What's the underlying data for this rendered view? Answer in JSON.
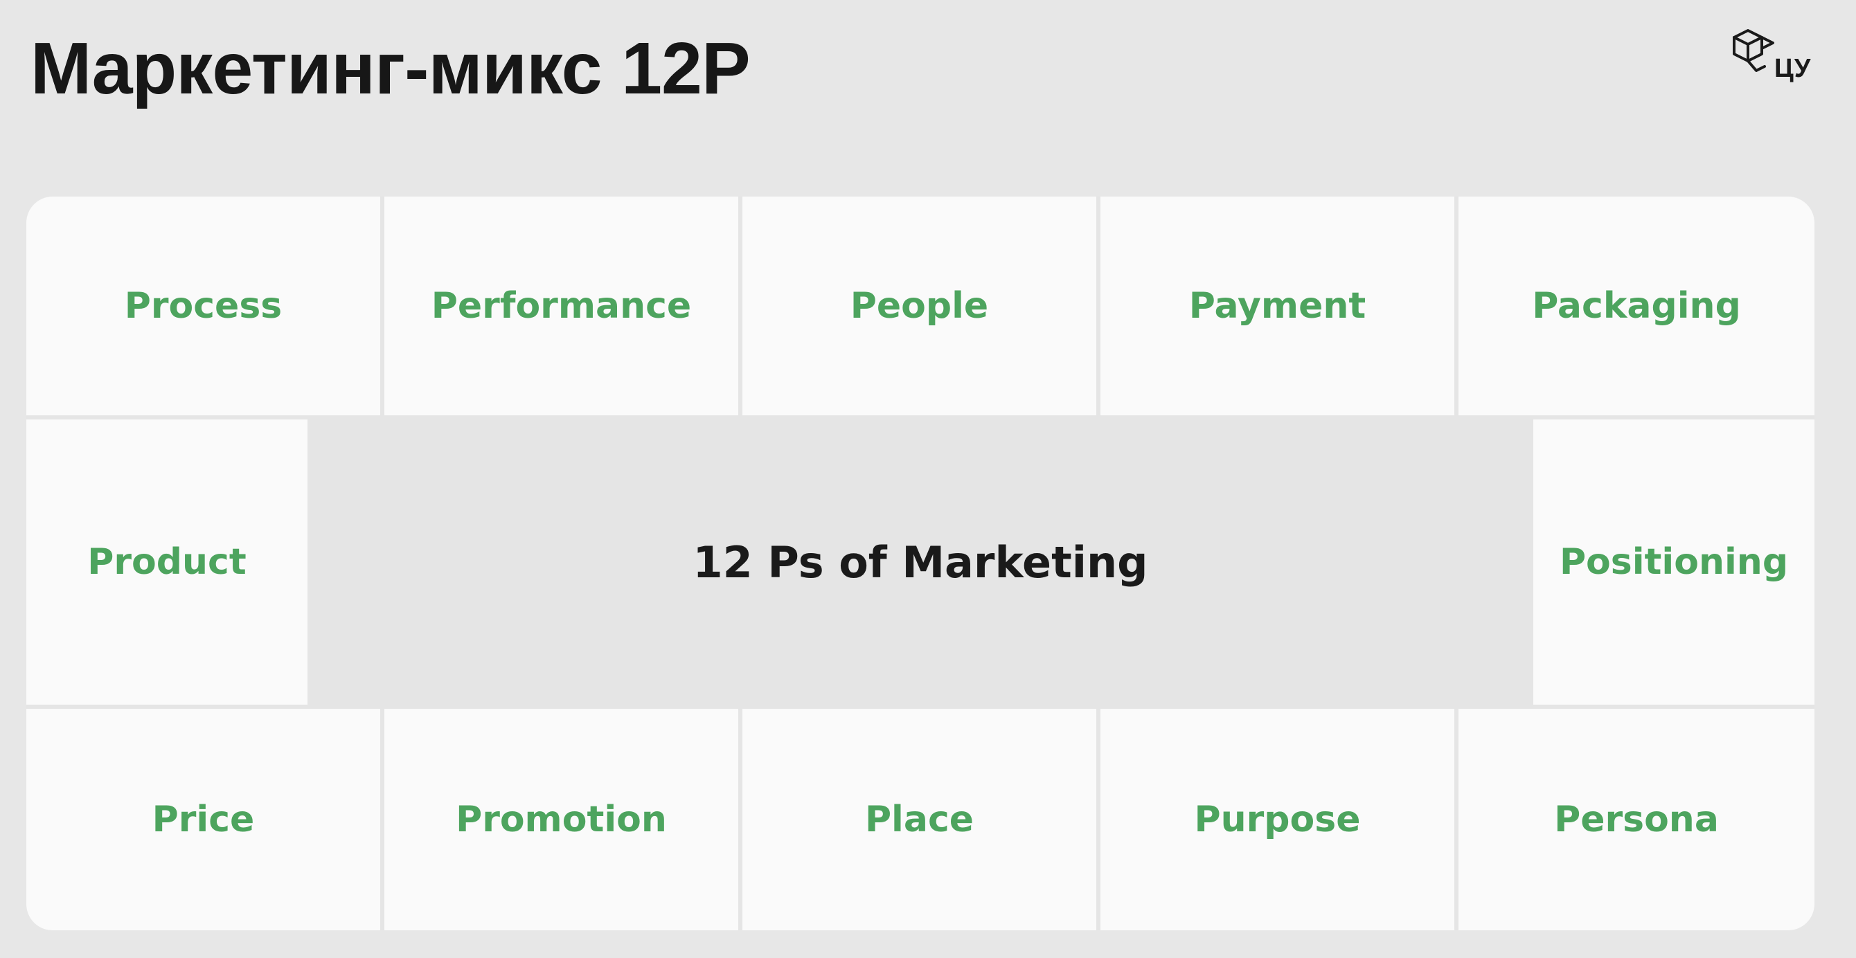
{
  "title": "Маркетинг-микс 12P",
  "logo": {
    "text": "ЦУ",
    "icon": "cube-logo-icon"
  },
  "colors": {
    "background": "#e7e7e7",
    "cell": "#fafafa",
    "accent_green": "#4da45e",
    "text_dark": "#1a1a1a"
  },
  "diagram": {
    "center_label": "12 Ps of Marketing",
    "top_row": [
      "Process",
      "Performance",
      "People",
      "Payment",
      "Packaging"
    ],
    "middle_left": "Product",
    "middle_right": "Positioning",
    "bottom_row": [
      "Price",
      "Promotion",
      "Place",
      "Purpose",
      "Persona"
    ]
  }
}
